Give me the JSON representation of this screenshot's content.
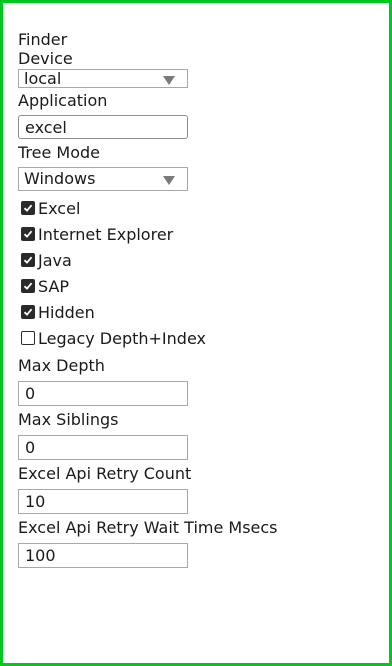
{
  "panel": {
    "title": "Finder",
    "device": {
      "label": "Device",
      "value": "local"
    },
    "application": {
      "label": "Application",
      "value": "excel"
    },
    "tree_mode": {
      "label": "Tree Mode",
      "value": "Windows"
    },
    "checkboxes": [
      {
        "label": "Excel",
        "checked": true
      },
      {
        "label": "Internet Explorer",
        "checked": true
      },
      {
        "label": "Java",
        "checked": true
      },
      {
        "label": "SAP",
        "checked": true
      },
      {
        "label": "Hidden",
        "checked": true
      },
      {
        "label": "Legacy Depth+Index",
        "checked": false
      }
    ],
    "max_depth": {
      "label": "Max Depth",
      "value": "0"
    },
    "max_siblings": {
      "label": "Max Siblings",
      "value": "0"
    },
    "excel_api_retry_count": {
      "label": "Excel Api Retry Count",
      "value": "10"
    },
    "excel_api_retry_wait": {
      "label": "Excel Api Retry Wait Time Msecs",
      "value": "100"
    }
  },
  "colors": {
    "frame_border": "#00c81e",
    "checkbox_fill": "#2a2a2a",
    "field_border": "#a8a8a8"
  },
  "icons": {
    "dropdown": "triangle-down",
    "check": "checkmark"
  }
}
